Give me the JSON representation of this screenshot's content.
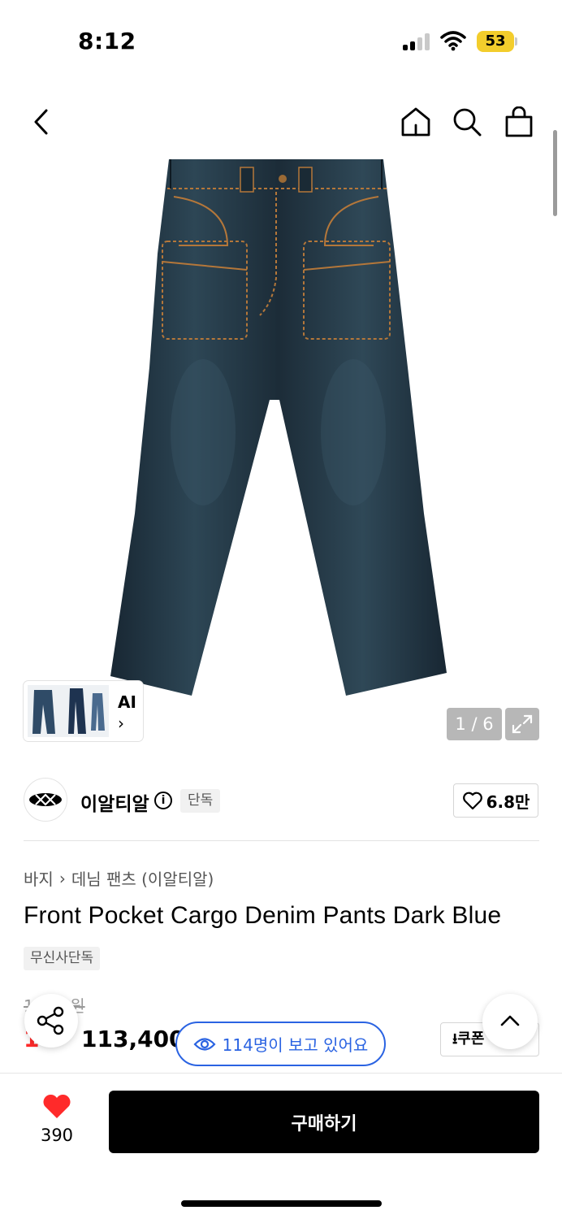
{
  "status_bar": {
    "time": "8:12",
    "battery": "53"
  },
  "header": {
    "icons": [
      "back-icon",
      "home-icon",
      "search-icon",
      "cart-icon"
    ]
  },
  "gallery": {
    "ai_label": "AI",
    "ai_chevron": "›",
    "counter": "1 / 6",
    "colors": {
      "denim": "#1f2f3a",
      "denim_light": "#3a5566",
      "stitch": "#b4773a"
    }
  },
  "brand": {
    "name": "이알티알",
    "info_icon": "i",
    "tag": "단독",
    "likes": "6.8만"
  },
  "breadcrumb": {
    "category": "바지",
    "separator": "›",
    "subcategory": "데님 팬츠 (이알티알)"
  },
  "product": {
    "title": "Front Pocket Cargo Denim Pants Dark Blue",
    "badge": "무신사단독",
    "original_price": "1  ,  00원",
    "discount": "1  ",
    "price": "113,400"
  },
  "viewers": {
    "text": "114명이 보고 있어요"
  },
  "coupon": {
    "label": "⭳쿠폰"
  },
  "bottom": {
    "heart_count": "390",
    "buy_label": "구매하기"
  },
  "colors": {
    "accent_red": "#ff2a2a",
    "viewer_blue": "#2a63e2",
    "battery_yellow": "#f3cd2c"
  }
}
